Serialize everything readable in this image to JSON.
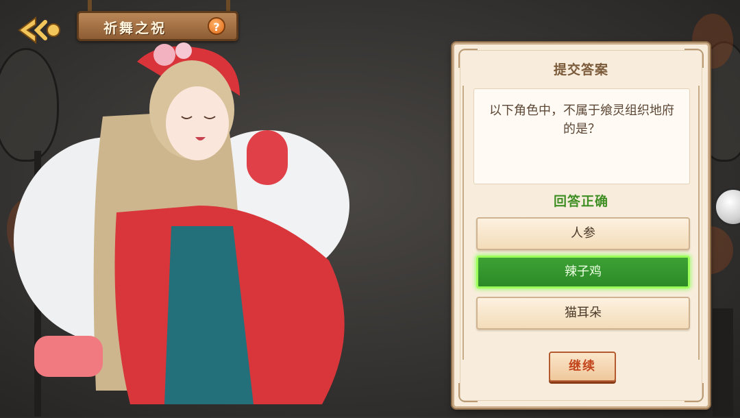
{
  "header": {
    "title": "祈舞之祝",
    "help_label": "?",
    "back_icon": "back-arrow-icon"
  },
  "panel": {
    "title": "提交答案",
    "question": "以下角色中，不属于飨灵组织地府的是？",
    "result": "回答正确",
    "options": [
      {
        "label": "人参",
        "state": "normal"
      },
      {
        "label": "辣子鸡",
        "state": "correct"
      },
      {
        "label": "猫耳朵",
        "state": "normal"
      }
    ],
    "continue_label": "继续"
  },
  "colors": {
    "correct_green": "#2c8a27",
    "result_text": "#3f8f24",
    "panel_bg": "#f8eddc",
    "accent_orange": "#e06a18"
  }
}
